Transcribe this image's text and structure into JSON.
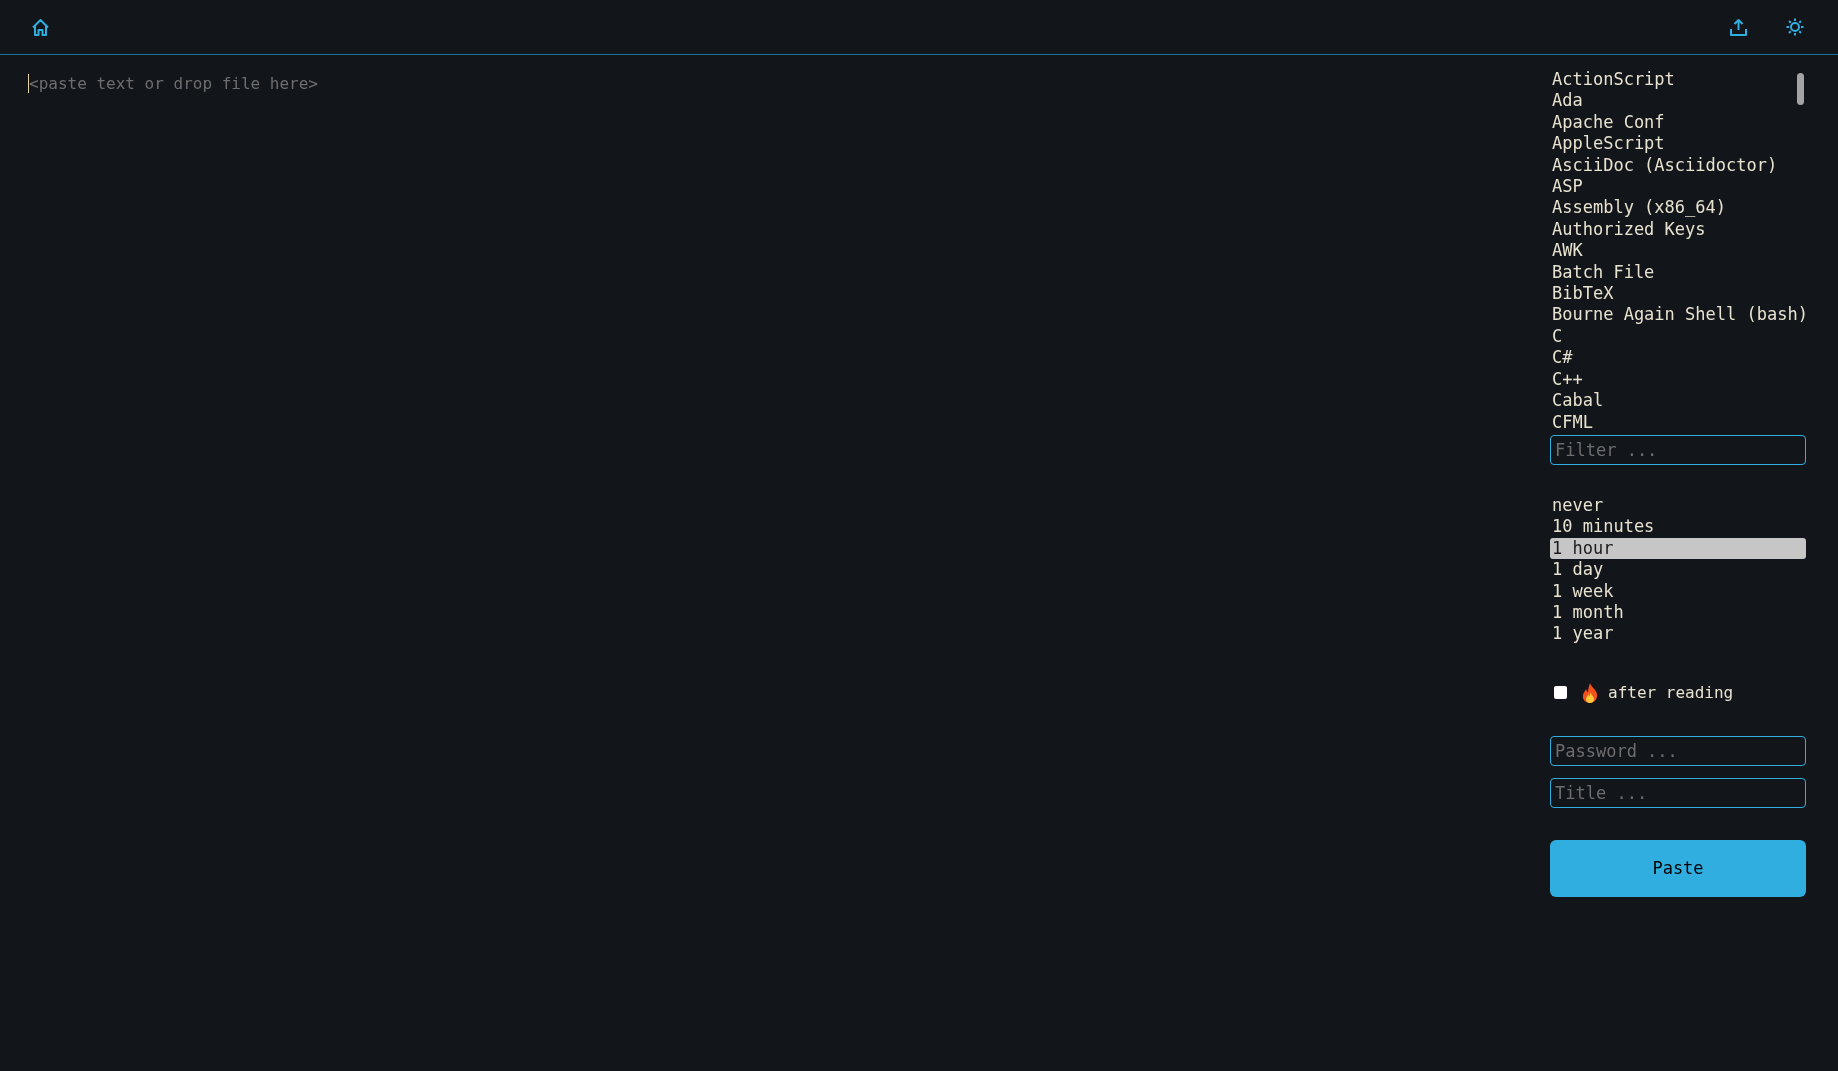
{
  "editor": {
    "placeholder": "<paste text or drop file here>"
  },
  "languages": {
    "items": [
      {
        "label": "ActionScript",
        "selected": false
      },
      {
        "label": "Ada",
        "selected": false
      },
      {
        "label": "Apache Conf",
        "selected": false
      },
      {
        "label": "AppleScript",
        "selected": false
      },
      {
        "label": "AsciiDoc (Asciidoctor)",
        "selected": false
      },
      {
        "label": "ASP",
        "selected": false
      },
      {
        "label": "Assembly (x86_64)",
        "selected": false
      },
      {
        "label": "Authorized Keys",
        "selected": false
      },
      {
        "label": "AWK",
        "selected": false
      },
      {
        "label": "Batch File",
        "selected": false
      },
      {
        "label": "BibTeX",
        "selected": false
      },
      {
        "label": "Bourne Again Shell (bash)",
        "selected": false
      },
      {
        "label": "C",
        "selected": false
      },
      {
        "label": "C#",
        "selected": false
      },
      {
        "label": "C++",
        "selected": false
      },
      {
        "label": "Cabal",
        "selected": false
      },
      {
        "label": "CFML",
        "selected": false
      }
    ],
    "filter": {
      "placeholder": "Filter ..."
    }
  },
  "expiration": {
    "items": [
      {
        "label": "never",
        "selected": false
      },
      {
        "label": "10 minutes",
        "selected": false
      },
      {
        "label": "1 hour",
        "selected": true
      },
      {
        "label": "1 day",
        "selected": false
      },
      {
        "label": "1 week",
        "selected": false
      },
      {
        "label": "1 month",
        "selected": false
      },
      {
        "label": "1 year",
        "selected": false
      }
    ]
  },
  "burn_after_reading": {
    "label": "after reading",
    "checked": false
  },
  "password": {
    "placeholder": "Password ..."
  },
  "title": {
    "placeholder": "Title ..."
  },
  "paste_button": {
    "label": "Paste"
  }
}
